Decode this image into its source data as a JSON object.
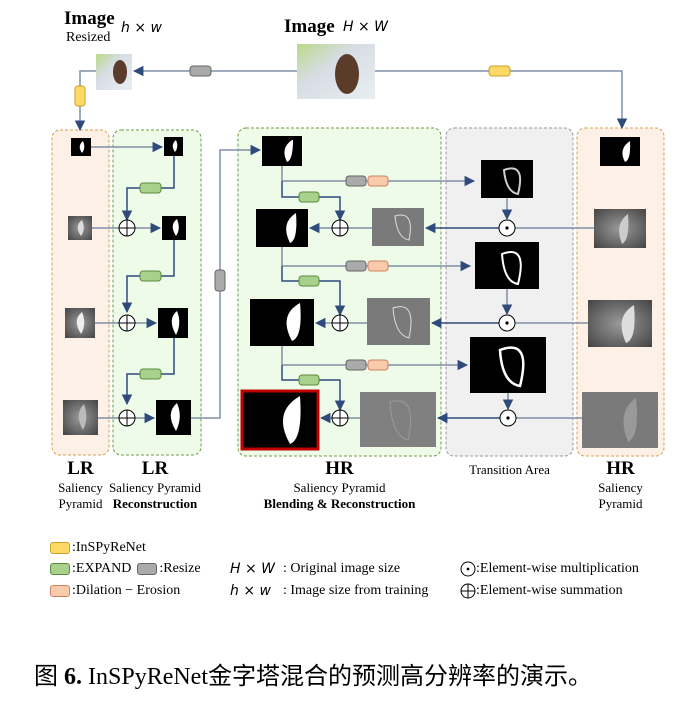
{
  "top": {
    "resized_title": "Image",
    "resized_sub": "Resized",
    "resized_size": "h × w",
    "orig_title": "Image",
    "orig_size": "H × W"
  },
  "columns": {
    "lr_pyramid": {
      "title": "LR",
      "line1": "Saliency",
      "line2": "Pyramid"
    },
    "lr_recon": {
      "title": "LR",
      "line1": "Saliency Pyramid",
      "line2": "Reconstruction"
    },
    "hr_blend": {
      "title": "HR",
      "line1": "Saliency Pyramid",
      "line2": "Blending & Reconstruction"
    },
    "transition": {
      "title": "Transition Area"
    },
    "hr_pyramid": {
      "title": "HR",
      "line1": "Saliency",
      "line2": "Pyramid"
    }
  },
  "legend": {
    "inspyrenet": ":InSPyReNet",
    "expand": ":EXPAND",
    "resize": ":Resize",
    "dilation": ":Dilation − Erosion",
    "orig_math": "H × W",
    "orig_desc": ": Original image size",
    "train_math": "h × w",
    "train_desc": ": Image size from training",
    "mult": ":Element-wise multiplication",
    "sum": ":Element-wise summation"
  },
  "colors": {
    "inspyrenet": "#ffd966",
    "expand": "#a9d18e",
    "resize": "#aaaaaa",
    "dilation": "#f8cbad",
    "lr_bg": "#fdf1e7",
    "green_bg": "#effbe9",
    "gray_bg": "#f0f0f0",
    "arrow": "#2f4b7c",
    "highlight": "#c00000"
  },
  "caption": {
    "prefix": "图",
    "number": "6.",
    "text": " InSPyReNet金字塔混合的预测高分辨率的演示。"
  }
}
